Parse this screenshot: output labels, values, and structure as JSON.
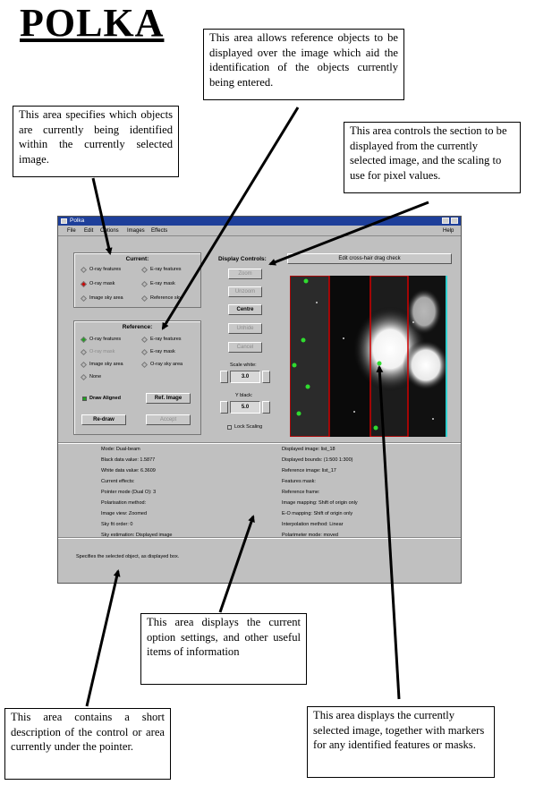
{
  "page": {
    "title": "POLKA"
  },
  "notes": {
    "reference_area": "This area allows reference objects to be displayed over the image which aid the identification of the objects currently being entered.",
    "current_area": "This area specifies which objects are currently being identified within the currently selected image.",
    "section_area": "This area controls the section to be displayed from the currently selected image, and the scaling to use for pixel values.",
    "options_area": "This area displays the current option settings, and other useful items of information",
    "description_area": "This area contains a short description of the control or area currently under the pointer.",
    "image_area": "This area displays the currently selected image, together with markers for any identified features or masks."
  },
  "window": {
    "title": "Polka",
    "menu": {
      "file": "File",
      "edit": "Edit",
      "options": "Options",
      "images": "Images",
      "effects": "Effects",
      "help": "Help"
    },
    "current": {
      "title": "Current:",
      "options": [
        "O-ray features",
        "E-ray features",
        "O-ray mask",
        "E-ray mask",
        "Image sky area",
        "Reference sky"
      ]
    },
    "reference": {
      "title": "Reference:",
      "options": [
        "O-ray features",
        "E-ray features",
        "O-ray mask",
        "E-ray mask",
        "Image sky area",
        "O-ray sky area",
        "None"
      ],
      "draw_aligned": "Draw Aligned",
      "ref_image": "Ref. Image",
      "redraw": "Re-draw",
      "accept": "Accept"
    },
    "display_controls": {
      "title": "Display Controls:",
      "buttons": [
        "Zoom",
        "Unzoom",
        "Centre",
        "Unhide",
        "Cancel"
      ],
      "white_label": "Scale white:",
      "white_value": "3.0",
      "black_label": "Y black:",
      "black_value": "5.0",
      "lock_scaling": "Lock Scaling",
      "section_button": "Edit cross-hair drag check"
    },
    "info_left": [
      "Mode:  Dual-beam",
      "Black data value:  1.5877",
      "White data value:  6.3609",
      "Current effects:",
      "Pointer mode (Dual O):  3",
      "Polarisation method:",
      "Image view:  Zoomed",
      "Sky fit order:  0",
      "Sky estimation:  Displayed image"
    ],
    "info_right": [
      "Displayed image:  list_18",
      "Displayed bounds:  (1:500 1:300)",
      "Reference image:  list_17",
      "Features mask:",
      "Reference frame:",
      "Image mapping:  Shift of origin only",
      "E-O mapping:  Shift of origin only",
      "Interpolation method:  Linear",
      "Polarimeter mode:  moved"
    ],
    "status_text": "Specifies the selected object, as displayed box."
  }
}
